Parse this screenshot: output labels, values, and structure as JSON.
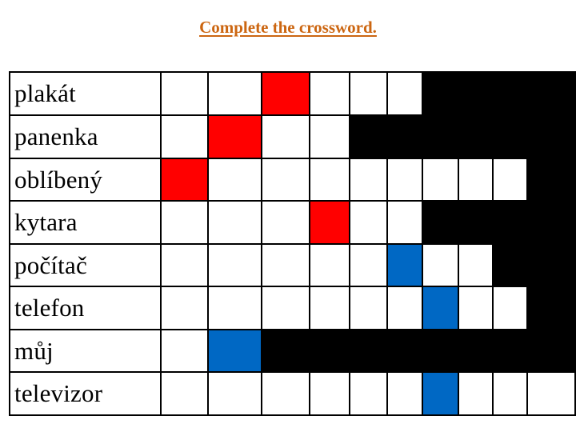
{
  "title": "Complete the crossword.",
  "colors": {
    "title": "#CC6611",
    "red": "#FF0000",
    "blue": "#0068C4",
    "black": "#000000",
    "white": "#FFFFFF"
  },
  "columns": 10,
  "rows": [
    {
      "word": "plakát",
      "cells": 6,
      "highlight": [
        {
          "index": 2,
          "color": "red"
        }
      ]
    },
    {
      "word": "panenka",
      "cells": 4,
      "highlight": [
        {
          "index": 1,
          "color": "red"
        }
      ]
    },
    {
      "word": "oblíbený",
      "cells": 9,
      "highlight": [
        {
          "index": 0,
          "color": "red"
        }
      ]
    },
    {
      "word": "kytara",
      "cells": 6,
      "highlight": [
        {
          "index": 3,
          "color": "red"
        }
      ]
    },
    {
      "word": "počítač",
      "cells": 8,
      "highlight": [
        {
          "index": 5,
          "color": "blue"
        }
      ]
    },
    {
      "word": "telefon",
      "cells": 9,
      "highlight": [
        {
          "index": 6,
          "color": "blue"
        }
      ]
    },
    {
      "word": "můj",
      "cells": 2,
      "highlight": [
        {
          "index": 1,
          "color": "blue"
        }
      ]
    },
    {
      "word": "televizor",
      "cells": 10,
      "highlight": [
        {
          "index": 6,
          "color": "blue"
        }
      ]
    }
  ]
}
